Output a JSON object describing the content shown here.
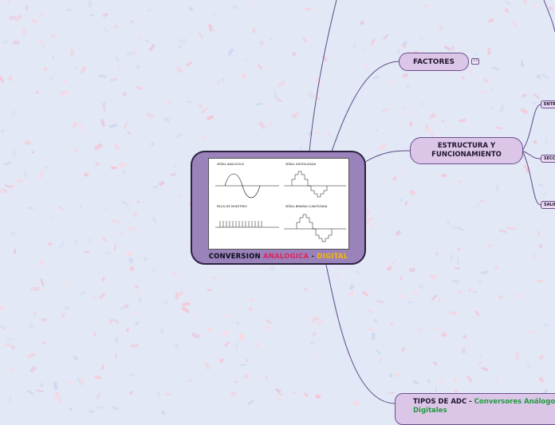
{
  "central": {
    "title_part1": "CONVERSION ",
    "title_part2": "ANALOGICA",
    "title_part3": " - ",
    "title_part4": "DIGITAL",
    "image": {
      "label_analog": "SEÑAL ANALÓGICA",
      "label_digital": "SEÑAL DIGITALIZADA",
      "label_clock": "RELOJ DE MUESTREO",
      "label_binary": "SEÑAL BINARIA CUANTIZADA"
    }
  },
  "nodes": {
    "factores": {
      "label": "FACTORES",
      "badge": "13"
    },
    "estructura": {
      "line1": "ESTRUCTURA Y",
      "line2": "FUNCIONAMIENTO"
    },
    "tipos": {
      "prefix": "TIPOS DE ADC - ",
      "highlight": "Conversores Análogos a Digitales"
    }
  },
  "subnodes": [
    {
      "label": "ENTRADA"
    },
    {
      "label": "SECCIÓN"
    },
    {
      "label": "SALIDA"
    }
  ],
  "colors": {
    "background": "#e3e8f6",
    "node_fill": "#dcc6e8",
    "node_border": "#6b4f8f",
    "central_fill": "#9a82ba",
    "connector": "#5e4a86",
    "title_pink": "#e0245e",
    "title_yellow": "#f2b705",
    "highlight_green": "#1f9a3e"
  }
}
